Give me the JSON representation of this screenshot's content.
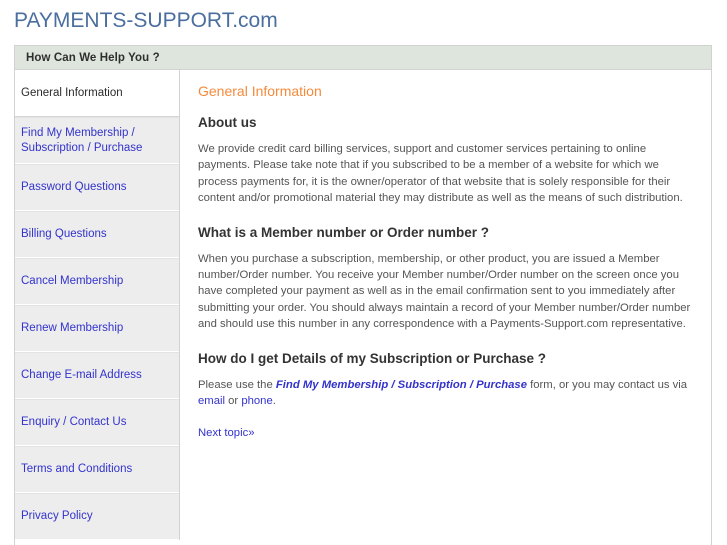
{
  "site": {
    "logo": "PAYMENTS-SUPPORT.com"
  },
  "helpbar": {
    "title": "How Can We Help You ?"
  },
  "sidebar": {
    "items": [
      {
        "label": "General Information",
        "active": true
      },
      {
        "label": "Find My Membership / Subscription / Purchase",
        "active": false
      },
      {
        "label": "Password Questions",
        "active": false
      },
      {
        "label": "Billing Questions",
        "active": false
      },
      {
        "label": "Cancel Membership",
        "active": false
      },
      {
        "label": "Renew Membership",
        "active": false
      },
      {
        "label": "Change E-mail Address",
        "active": false
      },
      {
        "label": "Enquiry / Contact Us",
        "active": false
      },
      {
        "label": "Terms and Conditions",
        "active": false
      },
      {
        "label": "Privacy Policy",
        "active": false
      }
    ]
  },
  "main": {
    "page_title": "General Information",
    "sections": [
      {
        "heading": "About us",
        "body": "We provide credit card billing services, support and customer services pertaining to online payments. Please take note that if you subscribed to be a member of a website for which we process payments for, it is the owner/operator of that website that is solely responsible for their content and/or promotional material they may distribute as well as the means of such distribution."
      },
      {
        "heading": "What is a Member number or Order number ?",
        "body": "When you purchase a subscription, membership, or other product, you are issued a Member number/Order number. You receive your Member number/Order number on the screen once you have completed your payment as well as in the email confirmation sent to you immediately after submitting your order. You should always maintain a record of your Member number/Order number and should use this number in any correspondence with a Payments-Support.com representative."
      }
    ],
    "details_section": {
      "heading": "How do I get Details of my Subscription or Purchase ?",
      "text_before_link": "Please use the ",
      "form_link": "Find My Membership / Subscription / Purchase",
      "text_after_form": " form, or you may contact us via ",
      "email_link": "email",
      "text_between": " or ",
      "phone_link": "phone",
      "text_end": "."
    },
    "next_topic": "Next topic»"
  },
  "colors": {
    "accent_orange": "#f58a3c",
    "link_blue": "#3333cc",
    "logo_blue": "#4a6e9e",
    "helpbar_green": "#dde5dc",
    "nav_gray": "#ededed",
    "border_gray": "#d2d2d2",
    "body_text": "#555555",
    "heading_text": "#333333"
  }
}
